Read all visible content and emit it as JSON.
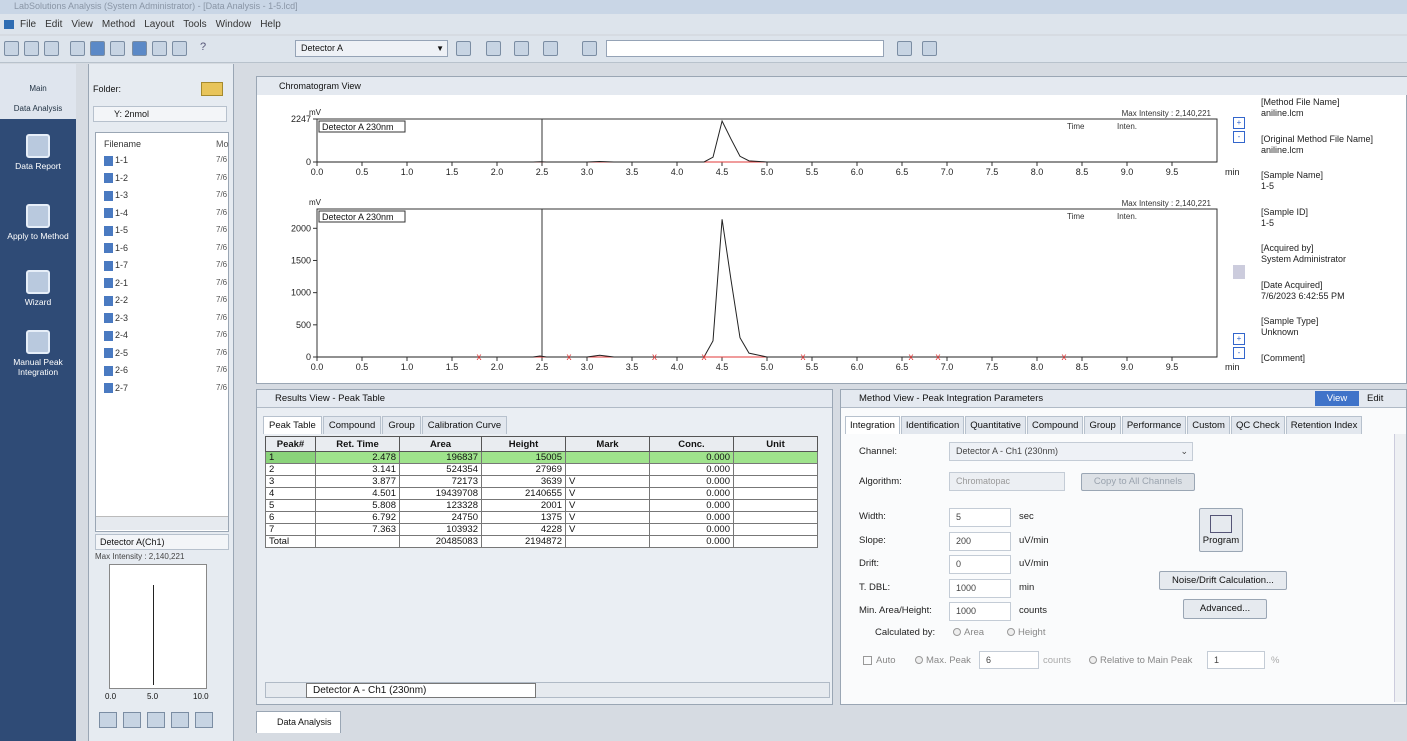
{
  "window": {
    "title": "LabSolutions Analysis (System Administrator) - [Data Analysis - 1-5.lcd]"
  },
  "menu": [
    "File",
    "Edit",
    "View",
    "Method",
    "Layout",
    "Tools",
    "Window",
    "Help"
  ],
  "toolbar": {
    "detector_select": "Detector A"
  },
  "nav": {
    "tabs": [
      "Main",
      "Data Analysis"
    ],
    "items": [
      "Data Report",
      "Apply to Method",
      "Wizard",
      "Manual Peak Integration"
    ]
  },
  "folder": {
    "label": "Folder:",
    "path": "Y: 2nmol",
    "col_filename": "Filename",
    "col_mod": "Mo",
    "files": [
      {
        "name": "1-1",
        "date": "7/6"
      },
      {
        "name": "1-2",
        "date": "7/6"
      },
      {
        "name": "1-3",
        "date": "7/6"
      },
      {
        "name": "1-4",
        "date": "7/6"
      },
      {
        "name": "1-5",
        "date": "7/6"
      },
      {
        "name": "1-6",
        "date": "7/6"
      },
      {
        "name": "1-7",
        "date": "7/6"
      },
      {
        "name": "2-1",
        "date": "7/6"
      },
      {
        "name": "2-2",
        "date": "7/6"
      },
      {
        "name": "2-3",
        "date": "7/6"
      },
      {
        "name": "2-4",
        "date": "7/6"
      },
      {
        "name": "2-5",
        "date": "7/6"
      },
      {
        "name": "2-6",
        "date": "7/6"
      },
      {
        "name": "2-7",
        "date": "7/6"
      }
    ],
    "preview_select": "Detector A(Ch1)",
    "preview_max": "Max Intensity : 2,140,221",
    "preview_ticks": [
      "0.0",
      "5.0",
      "10.0"
    ]
  },
  "chrom": {
    "title": "Chromatogram View",
    "unit": "mV",
    "trace_label": "Detector A 230nm",
    "max_intensity": "Max Intensity : 2,140,221",
    "col_time": "Time",
    "col_inten": "Inten.",
    "top_ytick": "2247",
    "top_y0": "0",
    "yticks": [
      "2000",
      "1500",
      "1000",
      "500",
      "0"
    ],
    "xticks": [
      "0.0",
      "0.5",
      "1.0",
      "1.5",
      "2.0",
      "2.5",
      "3.0",
      "3.5",
      "4.0",
      "4.5",
      "5.0",
      "5.5",
      "6.0",
      "6.5",
      "7.0",
      "7.5",
      "8.0",
      "8.5",
      "9.0",
      "9.5"
    ],
    "xunit": "min"
  },
  "info": [
    {
      "k": "[Method File Name]",
      "v": "aniline.lcm"
    },
    {
      "k": "[Original Method File Name]",
      "v": "aniline.lcm"
    },
    {
      "k": "[Sample Name]",
      "v": "1-5"
    },
    {
      "k": "[Sample ID]",
      "v": "1-5"
    },
    {
      "k": "[Acquired by]",
      "v": "System Administrator"
    },
    {
      "k": "[Date Acquired]",
      "v": "7/6/2023 6:42:55 PM"
    },
    {
      "k": "[Sample Type]",
      "v": "Unknown"
    },
    {
      "k": "[Comment]",
      "v": ""
    }
  ],
  "results": {
    "title": "Results View - Peak Table",
    "tabs": [
      "Peak Table",
      "Compound",
      "Group",
      "Calibration Curve"
    ],
    "headers": [
      "Peak#",
      "Ret. Time",
      "Area",
      "Height",
      "Mark",
      "Conc.",
      "Unit"
    ],
    "rows": [
      [
        "1",
        "2.478",
        "196837",
        "15005",
        "",
        "0.000",
        ""
      ],
      [
        "2",
        "3.141",
        "524354",
        "27969",
        "",
        "0.000",
        ""
      ],
      [
        "3",
        "3.877",
        "72173",
        "3639",
        "V",
        "0.000",
        ""
      ],
      [
        "4",
        "4.501",
        "19439708",
        "2140655",
        "V",
        "0.000",
        ""
      ],
      [
        "5",
        "5.808",
        "123328",
        "2001",
        "V",
        "0.000",
        ""
      ],
      [
        "6",
        "6.792",
        "24750",
        "1375",
        "V",
        "0.000",
        ""
      ],
      [
        "7",
        "7.363",
        "103932",
        "4228",
        "V",
        "0.000",
        ""
      ],
      [
        "Total",
        "",
        "20485083",
        "2194872",
        "",
        "0.000",
        ""
      ]
    ],
    "sheet_tab": "Detector A - Ch1 (230nm)"
  },
  "method": {
    "title": "Method View - Peak Integration Parameters",
    "view_btn": "View",
    "edit_btn": "Edit",
    "tabs": [
      "Integration",
      "Identification",
      "Quantitative",
      "Compound",
      "Group",
      "Performance",
      "Custom",
      "QC Check",
      "Retention Index"
    ],
    "channel_label": "Channel:",
    "channel_value": "Detector A - Ch1 (230nm)",
    "algorithm_label": "Algorithm:",
    "algorithm_value": "Chromatopac",
    "copy_btn": "Copy to All Channels",
    "params": [
      {
        "label": "Width:",
        "value": "5",
        "unit": "sec"
      },
      {
        "label": "Slope:",
        "value": "200",
        "unit": "uV/min"
      },
      {
        "label": "Drift:",
        "value": "0",
        "unit": "uV/min"
      },
      {
        "label": "T. DBL:",
        "value": "1000",
        "unit": "min"
      },
      {
        "label": "Min. Area/Height:",
        "value": "1000",
        "unit": "counts"
      }
    ],
    "program_btn": "Program",
    "noise_btn": "Noise/Drift Calculation...",
    "advanced_btn": "Advanced...",
    "calc_by": "Calculated by:",
    "opt_area": "Area",
    "opt_height": "Height",
    "auto": "Auto",
    "max_peak": "Max. Peak",
    "max_peak_val": "6",
    "counts": "counts",
    "rel_main": "Relative to Main Peak",
    "rel_val": "1",
    "pct": "%"
  },
  "bottom_tab": "Data Analysis",
  "colors": {
    "nav_bg": "#2f4b76",
    "selected_row": "#9fe38c",
    "baseline": "#e03a3a"
  },
  "chart_data": {
    "type": "line",
    "title": "Detector A 230nm",
    "xlabel": "min",
    "ylabel": "mV",
    "xlim": [
      0,
      10
    ],
    "ylim": [
      0,
      2247
    ],
    "series": [
      {
        "name": "Detector A 230nm",
        "x": [
          0,
          2.4,
          2.478,
          2.55,
          3.0,
          3.141,
          3.3,
          4.3,
          4.4,
          4.501,
          4.6,
          4.7,
          4.8,
          5.0,
          10.0
        ],
        "y": [
          0,
          0,
          15,
          0,
          0,
          28,
          0,
          0,
          250,
          2140,
          1200,
          300,
          60,
          0,
          0
        ]
      }
    ]
  }
}
